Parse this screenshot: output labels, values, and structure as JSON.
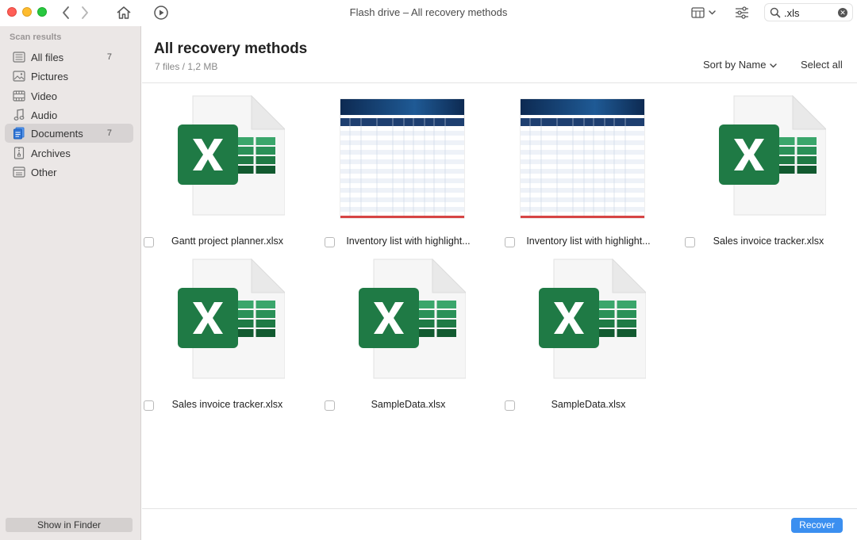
{
  "window": {
    "title": "Flash drive – All recovery methods"
  },
  "search": {
    "value": ".xls"
  },
  "sidebar": {
    "header": "Scan results",
    "items": [
      {
        "label": "All files",
        "count": "7",
        "icon": "all-files-icon"
      },
      {
        "label": "Pictures",
        "count": "",
        "icon": "pictures-icon"
      },
      {
        "label": "Video",
        "count": "",
        "icon": "video-icon"
      },
      {
        "label": "Audio",
        "count": "",
        "icon": "audio-icon"
      },
      {
        "label": "Documents",
        "count": "7",
        "icon": "documents-icon",
        "active": true
      },
      {
        "label": "Archives",
        "count": "",
        "icon": "archives-icon"
      },
      {
        "label": "Other",
        "count": "",
        "icon": "other-icon"
      }
    ],
    "show_in_finder": "Show in Finder"
  },
  "main": {
    "title": "All recovery methods",
    "subtitle": "7 files / 1,2 MB",
    "sort_label": "Sort by Name",
    "select_all": "Select all",
    "recover": "Recover"
  },
  "files": [
    {
      "name": "Gantt project planner.xlsx",
      "thumb": "excel-icon"
    },
    {
      "name": "Inventory list with highlight...",
      "thumb": "spreadsheet-preview"
    },
    {
      "name": "Inventory list with highlight...",
      "thumb": "spreadsheet-preview"
    },
    {
      "name": "Sales invoice tracker.xlsx",
      "thumb": "excel-icon"
    },
    {
      "name": "Sales invoice tracker.xlsx",
      "thumb": "excel-icon"
    },
    {
      "name": "SampleData.xlsx",
      "thumb": "excel-icon"
    },
    {
      "name": "SampleData.xlsx",
      "thumb": "excel-icon"
    }
  ],
  "colors": {
    "accent": "#3b8ff0",
    "excel_green": "#1f7a45",
    "sidebar_bg": "#ebe7e6"
  }
}
